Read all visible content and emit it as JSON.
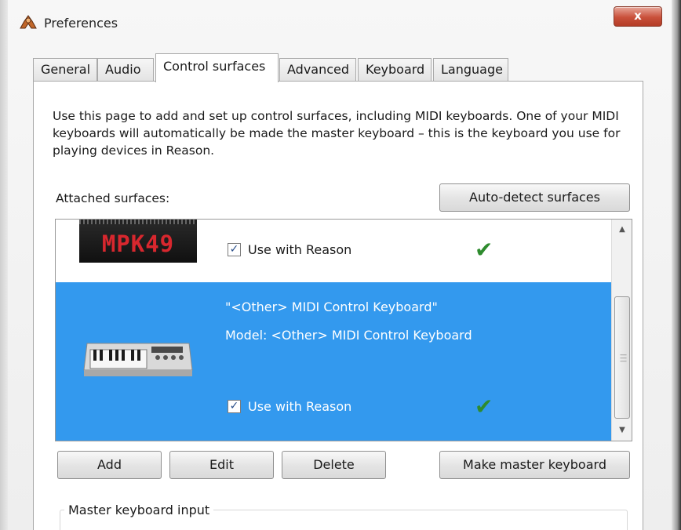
{
  "window": {
    "title": "Preferences",
    "close_glyph": "x"
  },
  "tabs": [
    {
      "label": "General"
    },
    {
      "label": "Audio"
    },
    {
      "label": "Control surfaces"
    },
    {
      "label": "Advanced"
    },
    {
      "label": "Keyboard"
    },
    {
      "label": "Language"
    }
  ],
  "active_tab": "Control surfaces",
  "intro_text": "Use this page to add and set up control surfaces, including MIDI keyboards. One of your MIDI keyboards will automatically be made the master keyboard – this is the keyboard you use for playing devices in Reason.",
  "attached_label": "Attached surfaces:",
  "auto_detect_label": "Auto-detect surfaces",
  "surfaces": [
    {
      "logo_text": "MPK49",
      "use_label": "Use with Reason",
      "checked": true,
      "status_glyph": "✔",
      "selected": false
    },
    {
      "name": "\"<Other> MIDI Control Keyboard\"",
      "model": "Model: <Other> MIDI Control Keyboard",
      "use_label": "Use with Reason",
      "checked": true,
      "status_glyph": "✔",
      "selected": true
    }
  ],
  "buttons": {
    "add": "Add",
    "edit": "Edit",
    "delete": "Delete",
    "make_master": "Make master keyboard"
  },
  "master_group_label": "Master keyboard input",
  "colors": {
    "selection": "#3399ee",
    "check_ok": "#2e8b2e",
    "close_button": "#c9503a"
  }
}
